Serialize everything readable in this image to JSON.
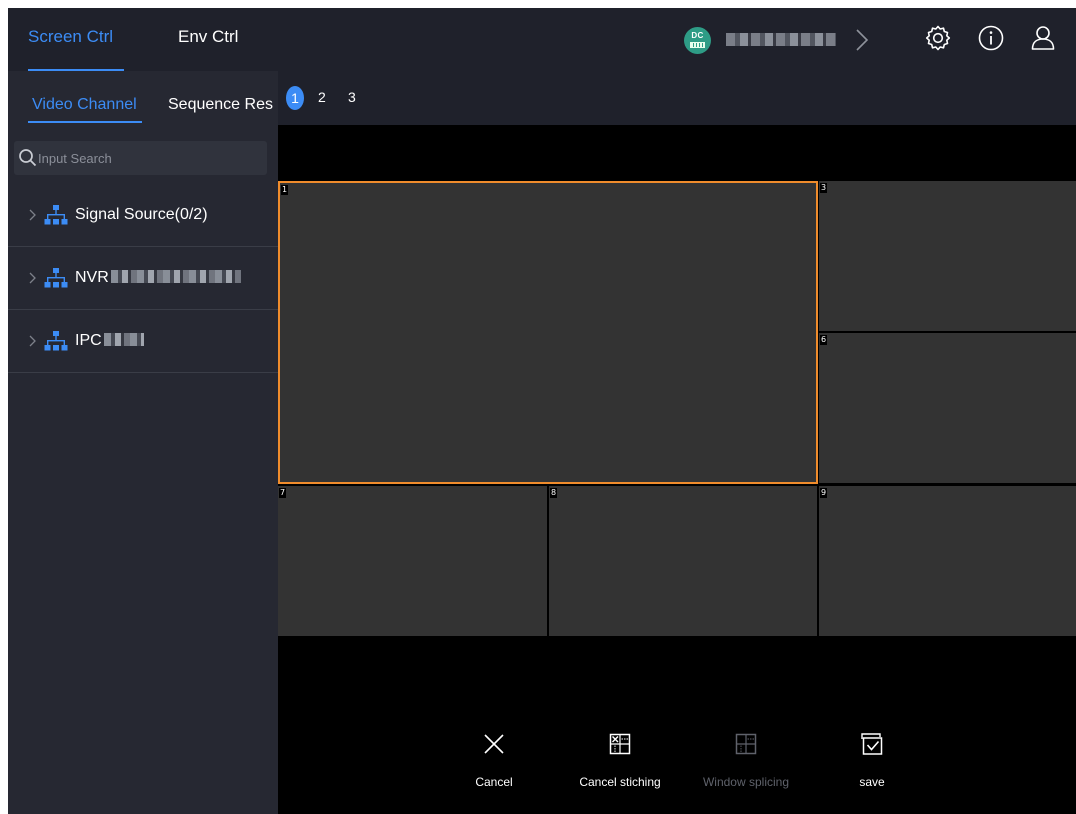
{
  "header": {
    "tabs": [
      {
        "label": "Screen Ctrl",
        "active": true
      },
      {
        "label": "Env Ctrl",
        "active": false
      }
    ],
    "device": {
      "badge": "DC",
      "color": "#2e9c86"
    },
    "icons": [
      "settings-icon",
      "info-icon",
      "user-icon"
    ]
  },
  "sidebar": {
    "tabs": [
      {
        "label": "Video Channel",
        "active": true
      },
      {
        "label": "Sequence Res",
        "active": false
      }
    ],
    "search": {
      "placeholder": "Input Search",
      "value": ""
    },
    "items": [
      {
        "label": "Signal Source(0/2)"
      },
      {
        "label": "NVR"
      },
      {
        "label": "IPC"
      }
    ]
  },
  "screens": {
    "pages": [
      "1",
      "2",
      "3"
    ],
    "active": "1"
  },
  "wall": {
    "windows": [
      {
        "id": "1",
        "selected": true
      },
      {
        "id": "3",
        "selected": false
      },
      {
        "id": "6",
        "selected": false
      },
      {
        "id": "7",
        "selected": false
      },
      {
        "id": "8",
        "selected": false
      },
      {
        "id": "9",
        "selected": false
      }
    ]
  },
  "toolbar": {
    "cancel": "Cancel",
    "cancel_stitching": "Cancel stiching",
    "window_splicing": "Window splicing",
    "save": "save"
  },
  "colors": {
    "accent": "#3c8cf5",
    "selection": "#f08c2c",
    "panel": "#262832",
    "topbar": "#1f212b",
    "window": "#333333"
  }
}
